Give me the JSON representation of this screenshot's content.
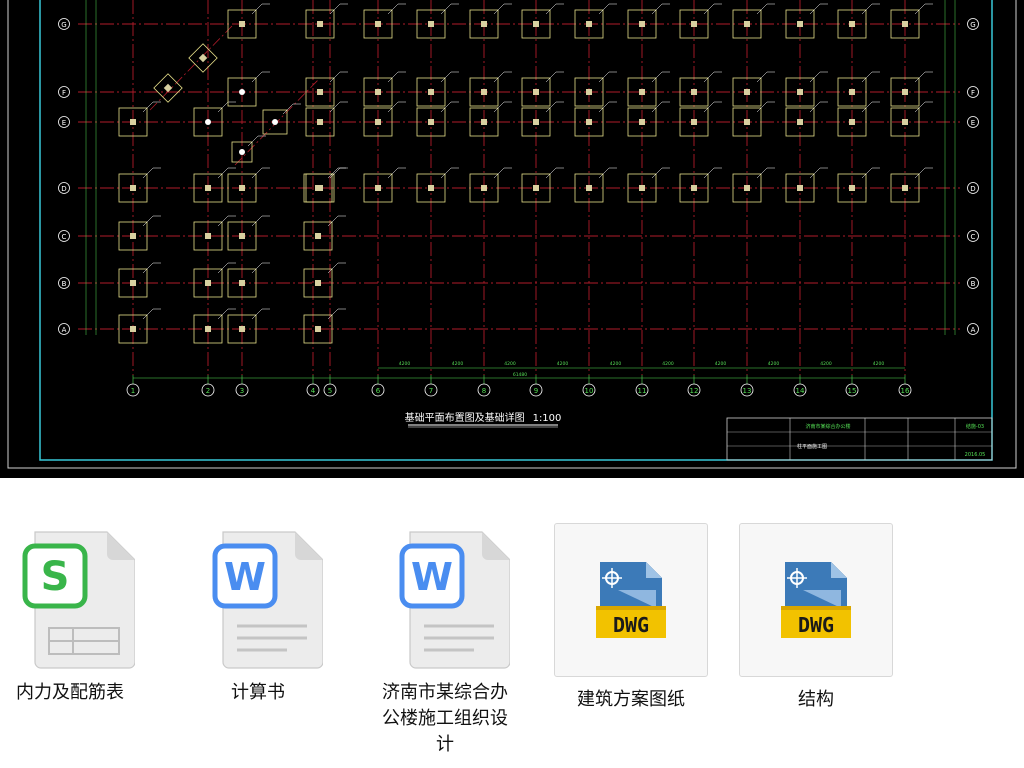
{
  "drawing": {
    "title": "基础平面布置图及基础详图",
    "scale": "1:100",
    "row_axes": [
      "G",
      "F",
      "E",
      "D",
      "C",
      "B",
      "A"
    ],
    "col_axes": [
      "1",
      "2",
      "3",
      "4",
      "5",
      "6",
      "7",
      "8",
      "9",
      "10",
      "11",
      "12",
      "13",
      "14",
      "15",
      "16"
    ],
    "spacing_labels": [
      "4200",
      "4200",
      "4200",
      "4200",
      "4200",
      "4200",
      "4200",
      "4200",
      "4200",
      "4200"
    ],
    "total_label": "61480",
    "title_block": {
      "project": "济南市某综合办公楼",
      "sheet": "柱平面施工图",
      "drawing_no": "结施-03",
      "date": "2016.05"
    }
  },
  "files": [
    {
      "name": "内力及配筋表",
      "type": "spreadsheet",
      "icon": "wps-sheet-icon",
      "color": "#3bb54a"
    },
    {
      "name": "计算书",
      "type": "document",
      "icon": "wps-writer-icon",
      "color": "#4a8df0"
    },
    {
      "name": "济南市某综合办公楼施工组织设计",
      "type": "document",
      "icon": "wps-writer-icon",
      "color": "#4a8df0"
    },
    {
      "name": "建筑方案图纸",
      "type": "dwg",
      "icon": "dwg-file-icon",
      "color": "#f2c200"
    },
    {
      "name": "结构",
      "type": "dwg",
      "icon": "dwg-file-icon",
      "color": "#f2c200"
    }
  ]
}
